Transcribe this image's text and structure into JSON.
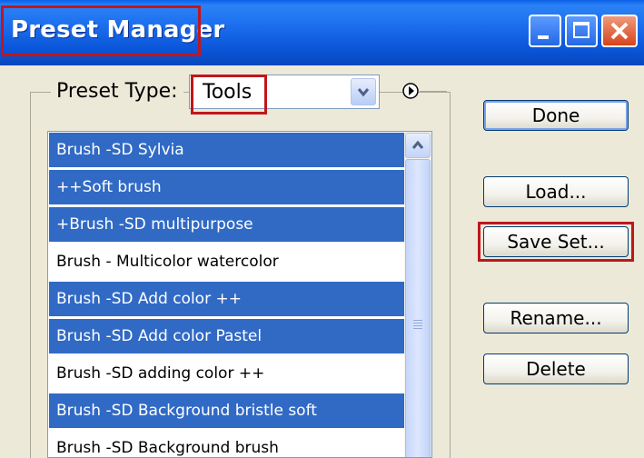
{
  "window": {
    "title": "Preset Manager"
  },
  "preset_type": {
    "label": "Preset Type:",
    "value": "Tools"
  },
  "presets": [
    {
      "label": "Brush -SD Sylvia",
      "selected": true
    },
    {
      "label": "++Soft brush",
      "selected": true
    },
    {
      "label": "+Brush -SD multipurpose",
      "selected": true
    },
    {
      "label": "Brush - Multicolor watercolor",
      "selected": false
    },
    {
      "label": "Brush -SD Add color ++",
      "selected": true
    },
    {
      "label": "Brush -SD Add color Pastel",
      "selected": true
    },
    {
      "label": "Brush -SD adding color ++",
      "selected": false
    },
    {
      "label": "Brush -SD Background bristle soft",
      "selected": true
    },
    {
      "label": "Brush -SD Background brush",
      "selected": false
    }
  ],
  "buttons": {
    "done": "Done",
    "load": "Load...",
    "save_set": "Save Set...",
    "rename": "Rename...",
    "delete": "Delete"
  },
  "colors": {
    "selection": "#316AC5",
    "highlight_box": "#C0161D",
    "titlebar": "#0A55D8"
  }
}
